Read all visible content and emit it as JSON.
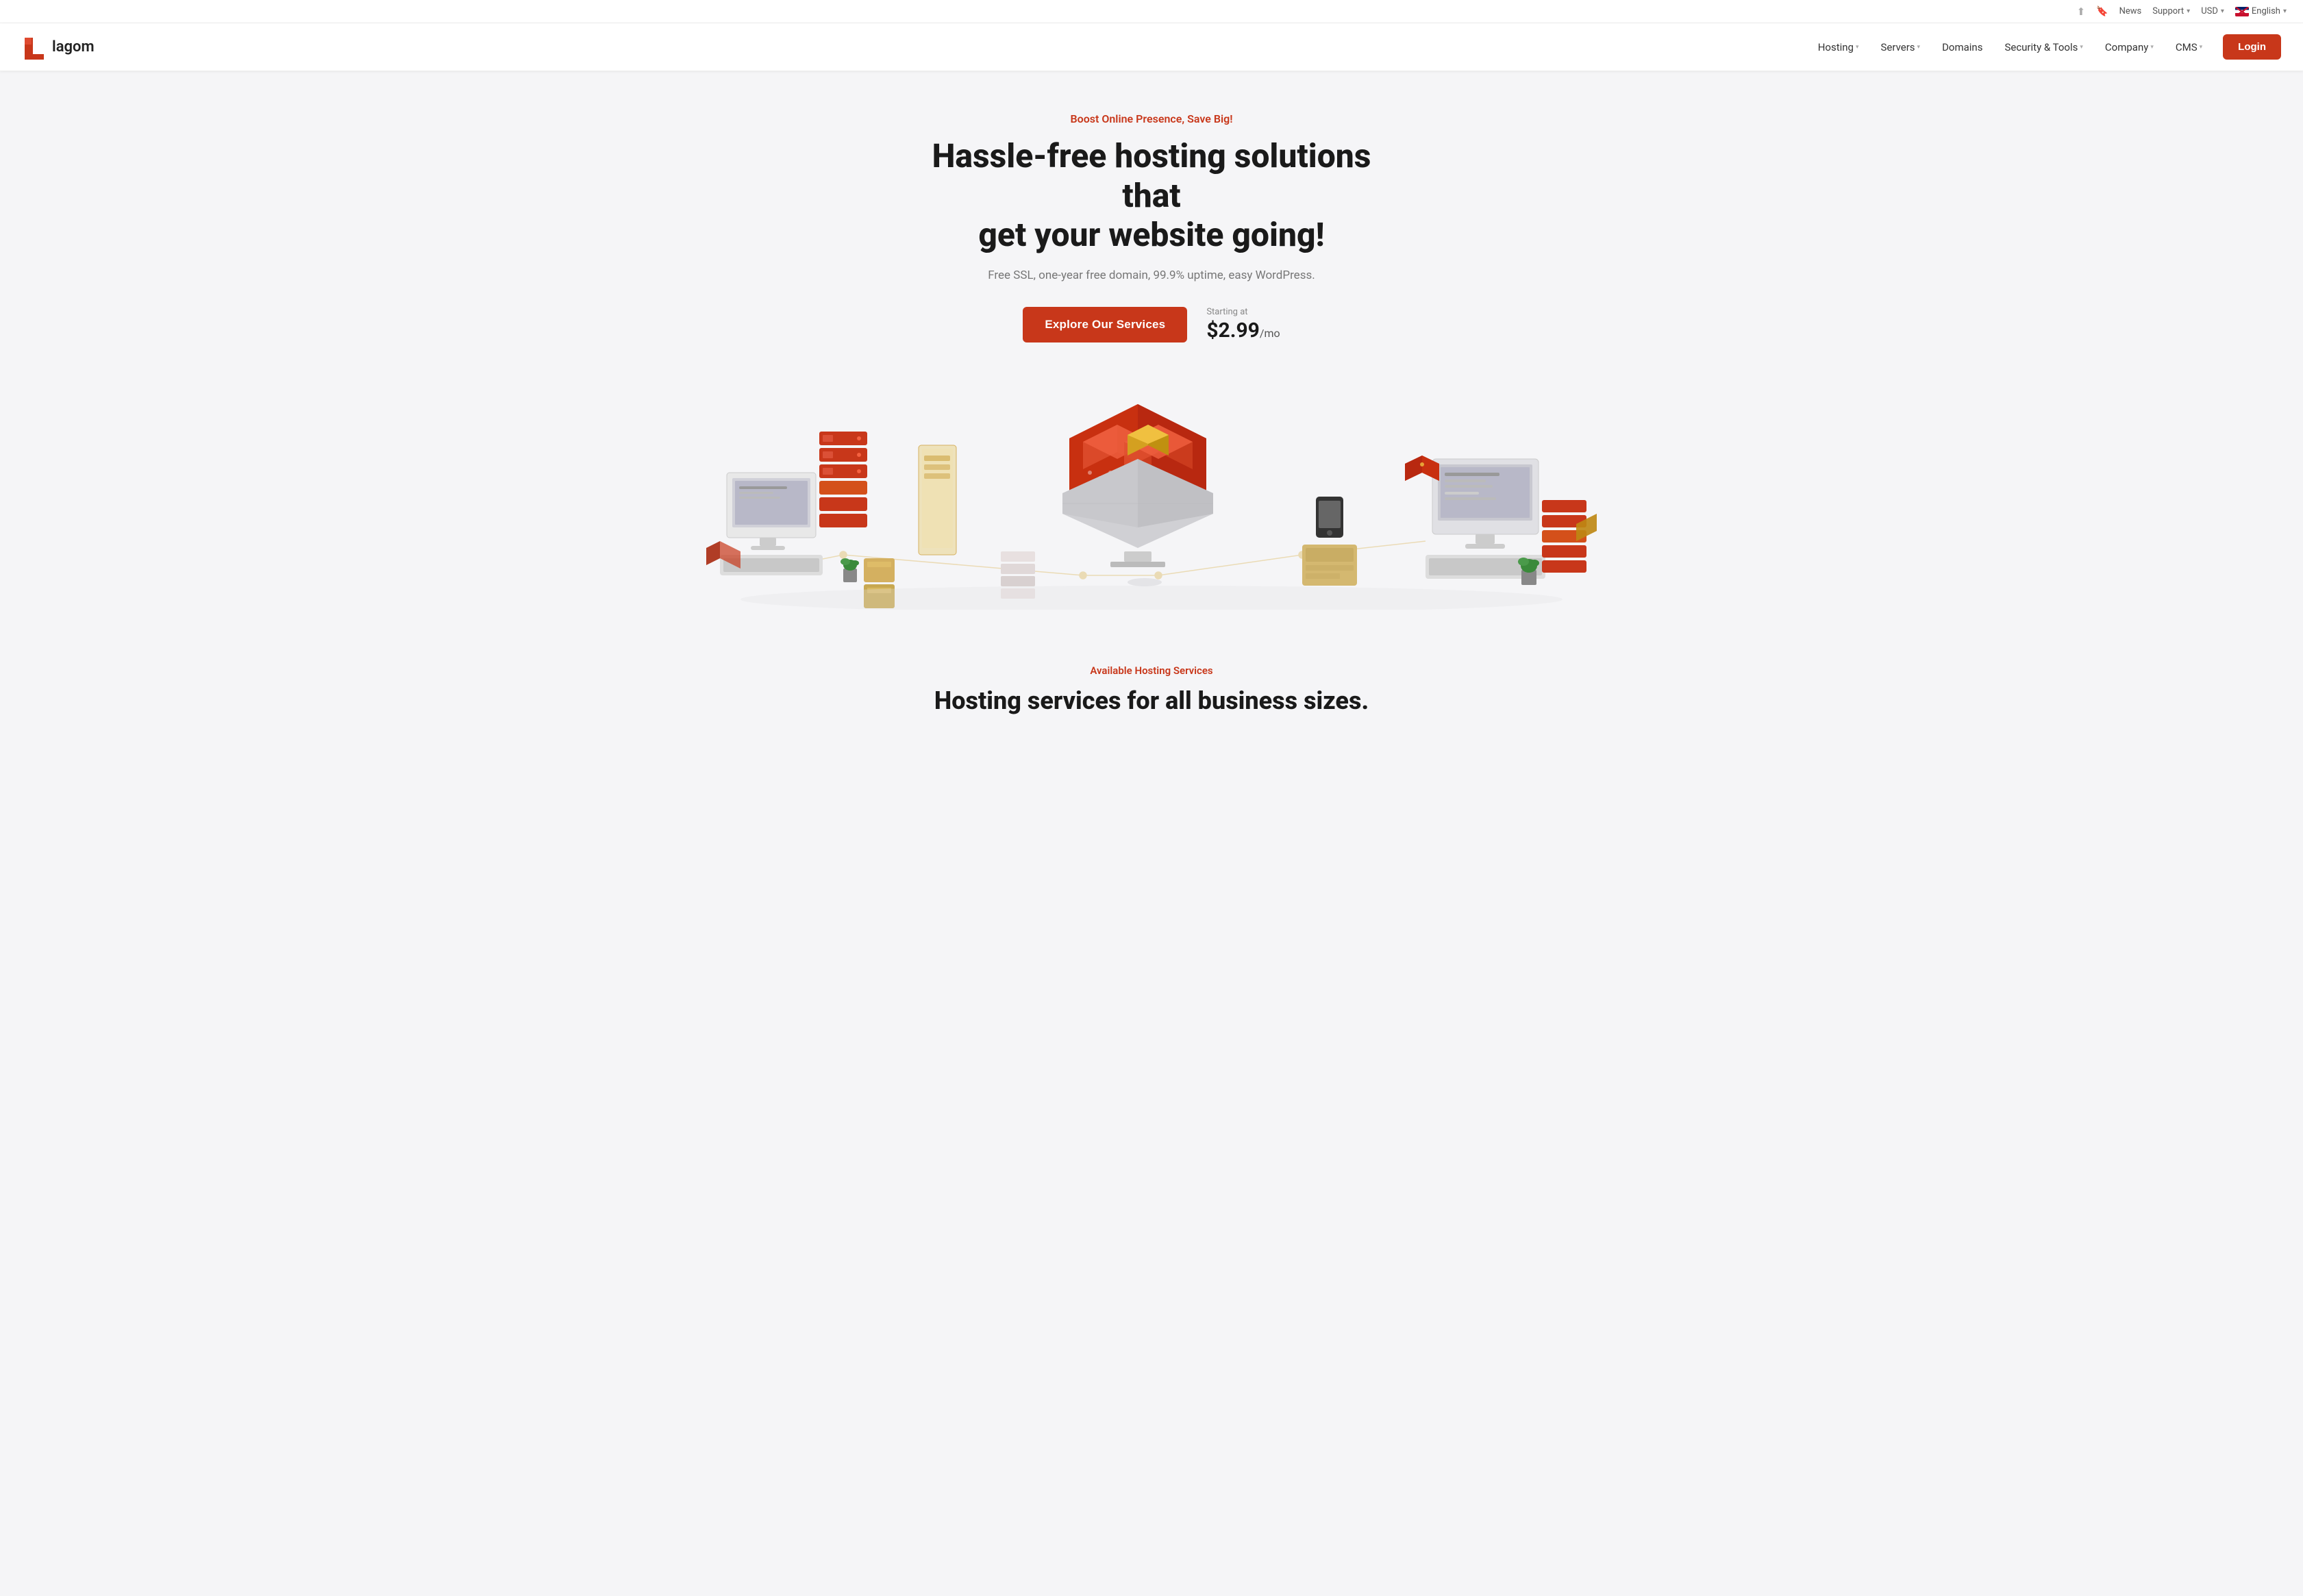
{
  "topbar": {
    "share_icon": "↗",
    "bookmark_icon": "🔖",
    "news_label": "News",
    "support_label": "Support",
    "currency_label": "USD",
    "language_label": "English"
  },
  "nav": {
    "logo_text": "lagom",
    "items": [
      {
        "label": "Hosting",
        "has_dropdown": true
      },
      {
        "label": "Servers",
        "has_dropdown": true
      },
      {
        "label": "Domains",
        "has_dropdown": false
      },
      {
        "label": "Security & Tools",
        "has_dropdown": true
      },
      {
        "label": "Company",
        "has_dropdown": true
      },
      {
        "label": "CMS",
        "has_dropdown": true
      }
    ],
    "login_label": "Login"
  },
  "hero": {
    "eyebrow": "Boost Online Presence, Save Big!",
    "title_line1": "Hassle-free hosting solutions that",
    "title_line2": "get your website going!",
    "subtitle": "Free SSL, one-year free domain, 99.9% uptime, easy WordPress.",
    "cta_label": "Explore Our Services",
    "price_starting": "Starting at",
    "price_amount": "$2.99",
    "price_suffix": "/mo"
  },
  "services": {
    "eyebrow": "Available Hosting Services",
    "title": "Hosting services for all business sizes."
  },
  "colors": {
    "accent": "#c8371a",
    "text_dark": "#1a1a1a",
    "text_muted": "#777"
  }
}
